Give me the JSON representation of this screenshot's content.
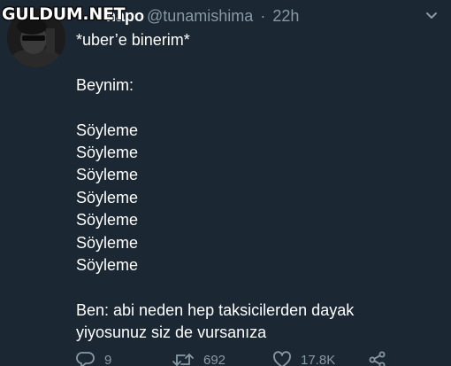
{
  "watermark": "GULDUM.NET",
  "tweet": {
    "display_name": "napo",
    "handle": "@tunamishima",
    "separator": "·",
    "time": "22h",
    "lines": [
      "*uber’e binerim*",
      "",
      "Beynim:",
      "",
      "Söyleme",
      "Söyleme",
      "Söyleme",
      "Söyleme",
      "Söyleme",
      "Söyleme",
      "Söyleme",
      "",
      "Ben: abi neden hep taksicilerden dayak",
      "yiyosunuz siz de vursanıza"
    ]
  },
  "actions": {
    "reply_count": "9",
    "retweet_count": "692",
    "like_count": "17.8K"
  },
  "icons": {
    "reply": "reply-icon",
    "retweet": "retweet-icon",
    "like": "heart-icon",
    "share": "share-icon",
    "caret": "chevron-down-icon"
  },
  "colors": {
    "background": "#1b2733",
    "text": "#ffffff",
    "muted": "#8899a6"
  }
}
